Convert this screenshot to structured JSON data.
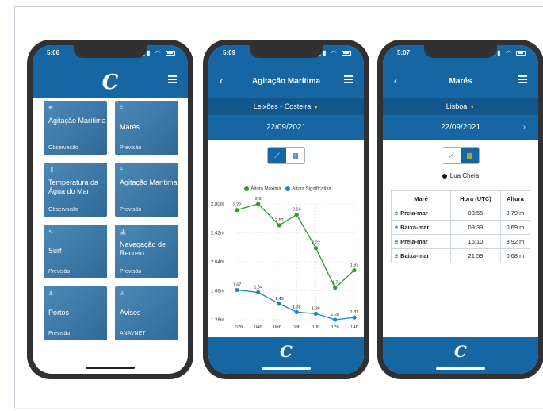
{
  "phone1": {
    "status_time": "5:06",
    "tiles": [
      {
        "icon": "waves-icon",
        "name": "Agitação Marítima",
        "sub": "Observação"
      },
      {
        "icon": "tide-icon",
        "name": "Marés",
        "sub": "Previsão"
      },
      {
        "icon": "thermometer-icon",
        "name": "Temperatura da Água do Mar",
        "sub": "Observação"
      },
      {
        "icon": "wave-forecast-icon",
        "name": "Agitação Marítima",
        "sub": "Previsão"
      },
      {
        "icon": "surf-icon",
        "name": "Surf",
        "sub": "Previsão"
      },
      {
        "icon": "sailboat-icon",
        "name": "Navegação de Recreio",
        "sub": "Previsão"
      },
      {
        "icon": "anchor-icon",
        "name": "Portos",
        "sub": "Previsão"
      },
      {
        "icon": "warning-icon",
        "name": "Avisos",
        "sub": "ANAVNET"
      }
    ]
  },
  "phone2": {
    "status_time": "5:09",
    "title": "Agitação Marítima",
    "location": "Leixões - Costeira",
    "date": "22/09/2021"
  },
  "phone3": {
    "status_time": "5:07",
    "title": "Marés",
    "location": "Lisboa",
    "date": "22/09/2021",
    "moon_phase": "Lua Cheia",
    "table_headers": [
      "Maré",
      "Hora (UTC)",
      "Altura"
    ],
    "rows": [
      {
        "tide": "Preia-mar",
        "time": "03:55",
        "height": "3.79 m"
      },
      {
        "tide": "Baixa-mar",
        "time": "09:39",
        "height": "0.69 m"
      },
      {
        "tide": "Preia-mar",
        "time": "16:10",
        "height": "3.92 m"
      },
      {
        "tide": "Baixa-mar",
        "time": "21:59",
        "height": "0.68 m"
      }
    ]
  },
  "chart_data": {
    "type": "line",
    "categories": [
      "02h",
      "04h",
      "06h",
      "08h",
      "10h",
      "12h",
      "14h"
    ],
    "yticks": [
      "2.80m",
      "2.42m",
      "2.04m",
      "1.66m",
      "1.28m"
    ],
    "ylim": [
      1.28,
      2.8
    ],
    "legend_placement": "top",
    "series": [
      {
        "name": "Altura Máxima",
        "color": "#2e9a2e",
        "x": [
          1.8,
          4,
          6.2,
          8,
          10,
          12,
          14
        ],
        "values": [
          2.72,
          2.8,
          2.52,
          2.66,
          2.22,
          1.7,
          1.93
        ]
      },
      {
        "name": "Altura Significativa",
        "color": "#1a86c8",
        "x": [
          1.8,
          4,
          6.2,
          8,
          10,
          12,
          14
        ],
        "values": [
          1.67,
          1.64,
          1.49,
          1.38,
          1.36,
          1.28,
          1.31
        ]
      }
    ]
  }
}
